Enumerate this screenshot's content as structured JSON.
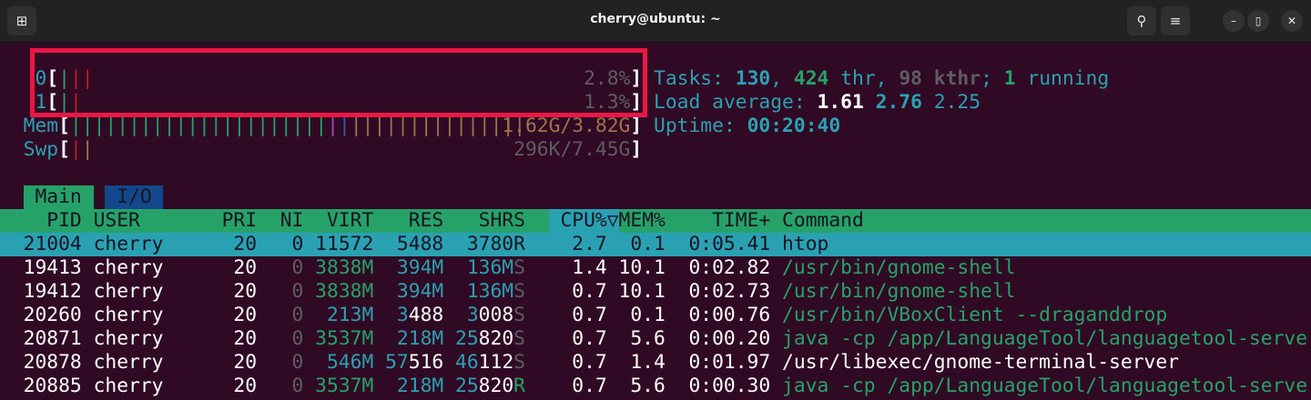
{
  "window": {
    "title": "cherry@ubuntu: ~",
    "buttons": {
      "new_tab": "new-tab-icon",
      "search": "search-icon",
      "menu": "hamburger-menu-icon",
      "minimize": "minimize-icon",
      "maximize": "maximize-icon",
      "close": "close-icon"
    }
  },
  "colors": {
    "background": "#300a24",
    "cyan": "#2aa1b3",
    "green": "#26a269",
    "gray": "#5e5c64",
    "red": "#c01c28",
    "orange": "#a2734c",
    "annotation": "#ea1744"
  },
  "meters": {
    "cpu": [
      {
        "label": "0",
        "value": "2.8%",
        "bars": [
          "green",
          "red",
          "red"
        ]
      },
      {
        "label": "1",
        "value": "1.3%",
        "bars": [
          "green",
          "red"
        ]
      }
    ],
    "mem": {
      "label": "Mem",
      "value": "1.62G/3.82G",
      "bars": {
        "green": 22,
        "mag": 1,
        "blue": 1,
        "orange": 15
      }
    },
    "swp": {
      "label": "Swp",
      "value": "296K/7.45G",
      "bars": {
        "red": 1,
        "orange": 1
      }
    }
  },
  "stats": {
    "tasks_label": "Tasks: ",
    "tasks": "130",
    "threads": "424",
    "thr_label": " thr, ",
    "kthreads": "98 kthr",
    "running": "1",
    "running_label": " running",
    "load_label": "Load average: ",
    "load1": "1.61",
    "load5": "2.76",
    "load15": "2.25",
    "uptime_label": "Uptime: ",
    "uptime": "00:20:40"
  },
  "tabs": [
    {
      "label": "Main",
      "active": true
    },
    {
      "label": "I/O",
      "active": false
    }
  ],
  "columns": {
    "pid": "PID",
    "user": "USER",
    "pri": "PRI",
    "ni": "NI",
    "virt": "VIRT",
    "res": "RES",
    "shr": "SHR",
    "s": "S",
    "cpu": "CPU%▽",
    "mem": "MEM%",
    "time": "TIME+",
    "command": "Command",
    "sort_column": "cpu"
  },
  "processes": [
    {
      "pid": "21004",
      "user": "cherry",
      "pri": "20",
      "ni": "0",
      "virt": "11572",
      "res": "5488",
      "shr": "3780",
      "s": "R",
      "cpu": "2.7",
      "mem": "0.1",
      "time": "0:05.41",
      "command": "htop",
      "selected": true,
      "command_color": "dark"
    },
    {
      "pid": "19413",
      "user": "cherry",
      "pri": "20",
      "ni": "0",
      "virt": "3838M",
      "res": "394M",
      "shr": "136M",
      "s": "S",
      "cpu": "1.4",
      "mem": "10.1",
      "time": "0:02.82",
      "command": "/usr/bin/gnome-shell",
      "command_color": "green"
    },
    {
      "pid": "19412",
      "user": "cherry",
      "pri": "20",
      "ni": "0",
      "virt": "3838M",
      "res": "394M",
      "shr": "136M",
      "s": "S",
      "cpu": "0.7",
      "mem": "10.1",
      "time": "0:02.73",
      "command": "/usr/bin/gnome-shell",
      "command_color": "green"
    },
    {
      "pid": "20260",
      "user": "cherry",
      "pri": "20",
      "ni": "0",
      "virt": "213M",
      "res": "3488",
      "shr": "3008",
      "s": "S",
      "cpu": "0.7",
      "mem": "0.1",
      "time": "0:00.76",
      "command": "/usr/bin/VBoxClient --draganddrop",
      "command_color": "green"
    },
    {
      "pid": "20871",
      "user": "cherry",
      "pri": "20",
      "ni": "0",
      "virt": "3537M",
      "res": "218M",
      "shr": "25820",
      "s": "S",
      "cpu": "0.7",
      "mem": "5.6",
      "time": "0:00.20",
      "command": "java -cp /app/LanguageTool/languagetool-serve",
      "command_color": "green"
    },
    {
      "pid": "20878",
      "user": "cherry",
      "pri": "20",
      "ni": "0",
      "virt": "546M",
      "res": "57516",
      "shr": "46112",
      "s": "S",
      "cpu": "0.7",
      "mem": "1.4",
      "time": "0:01.97",
      "command": "/usr/libexec/gnome-terminal-server",
      "command_color": "white"
    },
    {
      "pid": "20885",
      "user": "cherry",
      "pri": "20",
      "ni": "0",
      "virt": "3537M",
      "res": "218M",
      "shr": "25820",
      "s": "R",
      "cpu": "0.7",
      "mem": "5.6",
      "time": "0:00.30",
      "command": "java -cp /app/LanguageTool/languagetool-serve",
      "command_color": "green"
    }
  ]
}
